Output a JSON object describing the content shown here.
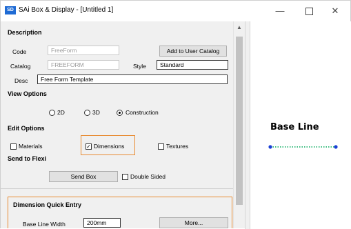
{
  "window": {
    "title": "SAi Box & Display - [Untitled 1]",
    "icon_text": "SD",
    "controls": {
      "minimize": "—",
      "close": "✕"
    }
  },
  "description": {
    "header": "Description",
    "code_label": "Code",
    "code_value": "FreeForm",
    "catalog_label": "Catalog",
    "catalog_value": "FREEFORM",
    "add_catalog_button": "Add to User Catalog",
    "style_label": "Style",
    "style_value": "Standard",
    "desc_label": "Desc",
    "desc_value": "Free Form Template"
  },
  "view_options": {
    "header": "View Options",
    "options": [
      "2D",
      "3D",
      "Construction"
    ],
    "selected": "Construction"
  },
  "edit_options": {
    "header": "Edit Options",
    "materials": "Materials",
    "dimensions": "Dimensions",
    "textures": "Textures",
    "dimensions_checked": true
  },
  "send_to_flexi": {
    "header": "Send to Flexi",
    "send_box_button": "Send Box",
    "double_sided": "Double Sided"
  },
  "dimension_quick_entry": {
    "header": "Dimension Quick Entry",
    "base_line_width_label": "Base Line Width",
    "base_line_width_value": "200mm",
    "more_button": "More..."
  },
  "preview": {
    "title": "Base Line",
    "line_color": "#00a859",
    "point_color": "#1a3fd6"
  },
  "icons": [
    "app-icon",
    "minimize-icon",
    "maximize-icon",
    "close-icon",
    "scroll-up-icon"
  ]
}
